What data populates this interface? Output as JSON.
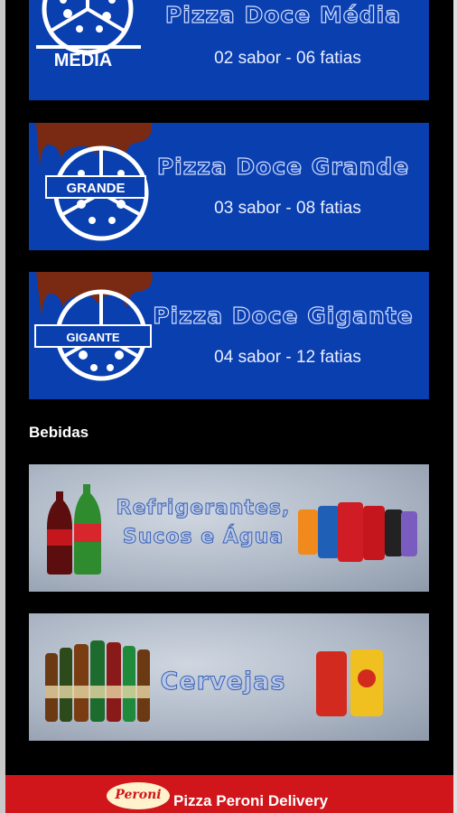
{
  "menu": {
    "pizzas": [
      {
        "title": "Pizza Doce Média",
        "subtitle": "02 sabor - 06 fatias",
        "badge": "MÉDIA"
      },
      {
        "title": "Pizza Doce Grande",
        "subtitle": "03 sabor - 08 fatias",
        "badge": "GRANDE"
      },
      {
        "title": "Pizza Doce Gigante",
        "subtitle": "04 sabor - 12 fatias",
        "badge": "GIGANTE"
      }
    ],
    "drinks_section_title": "Bebidas",
    "drinks": [
      {
        "title_line1": "Refrigerantes,",
        "title_line2": "Sucos e Água"
      },
      {
        "title_line1": "Cervejas"
      }
    ]
  },
  "footer": {
    "logo_text": "Peroni",
    "label": "Pizza Peroni Delivery"
  },
  "colors": {
    "card_blue": "#0a3fb0",
    "footer_red": "#d0161b",
    "background": "#000000"
  }
}
